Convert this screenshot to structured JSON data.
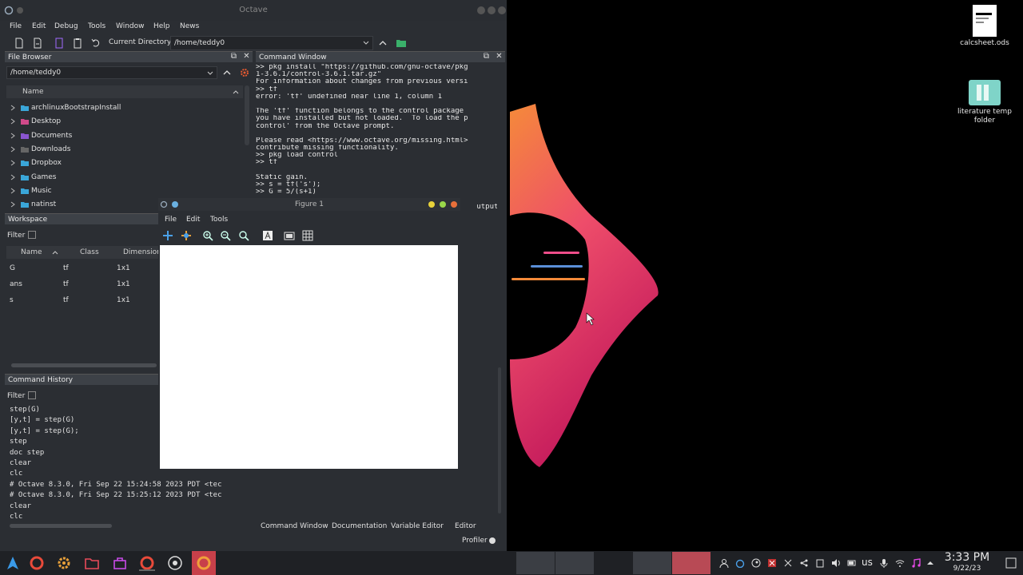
{
  "octave": {
    "title": "Octave",
    "menu": [
      "File",
      "Edit",
      "Debug",
      "Tools",
      "Window",
      "Help",
      "News"
    ],
    "current_directory_label": "Current Directory:",
    "current_directory": "/home/teddy0"
  },
  "file_browser": {
    "title": "File Browser",
    "path": "/home/teddy0",
    "column": "Name",
    "items": [
      {
        "name": "archlinuxBootstrapInstall",
        "color": "#3aa6d8"
      },
      {
        "name": "Desktop",
        "color": "#d04a8a"
      },
      {
        "name": "Documents",
        "color": "#8a55d0"
      },
      {
        "name": "Downloads",
        "color": "#666666"
      },
      {
        "name": "Dropbox",
        "color": "#3aa6d8"
      },
      {
        "name": "Games",
        "color": "#3aa6d8"
      },
      {
        "name": "Music",
        "color": "#3aa6d8"
      },
      {
        "name": "natinst",
        "color": "#3aa6d8"
      }
    ]
  },
  "workspace": {
    "title": "Workspace",
    "filter_label": "Filter",
    "columns": [
      "Name",
      "Class",
      "Dimension"
    ],
    "rows": [
      {
        "name": "G",
        "class": "tf",
        "dim": "1x1"
      },
      {
        "name": "ans",
        "class": "tf",
        "dim": "1x1"
      },
      {
        "name": "s",
        "class": "tf",
        "dim": "1x1"
      }
    ]
  },
  "history": {
    "title": "Command History",
    "filter_label": "Filter",
    "lines": [
      "step(G)",
      "[y,t] = step(G)",
      "[y,t] = step(G);",
      "step",
      "doc step",
      "clear",
      "clc",
      "# Octave 8.3.0, Fri Sep 22 15:24:58 2023 PDT <tec",
      "# Octave 8.3.0, Fri Sep 22 15:25:12 2023 PDT <tec",
      "clear",
      "clc"
    ]
  },
  "command_window": {
    "title": "Command Window",
    "lines": [
      ">> pkg install \"https://github.com/gnu-octave/pkg",
      "1-3.6.1/control-3.6.1.tar.gz\"",
      "For information about changes from previous versi",
      ">> tf",
      "error: 'tf' undefined near line 1, column 1",
      "",
      "The 'tf' function belongs to the control package",
      "you have installed but not loaded.  To load the p",
      "control' from the Octave prompt.",
      "",
      "Please read <https://www.octave.org/missing.html>",
      "contribute missing functionality.",
      ">> pkg load control",
      ">> tf",
      "",
      "Static gain.",
      ">> s = tf('s');",
      ">> G = 5/(s+1)",
      "",
      "                                                   utput ."
    ]
  },
  "bottom_tabs": [
    "Command Window",
    "Documentation",
    "Variable Editor",
    "Editor"
  ],
  "profiler_label": "Profiler",
  "figure": {
    "title": "Figure 1",
    "menu": [
      "File",
      "Edit",
      "Tools"
    ]
  },
  "desktop_icons": [
    {
      "label": "calcsheet.ods"
    },
    {
      "label": "literature temp folder"
    }
  ],
  "tray": {
    "keyboard_layout": "us",
    "time": "3:33 PM",
    "date": "9/22/23"
  },
  "colors": {
    "wallpaper_top": "#f58a3a",
    "wallpaper_bottom": "#c2185b",
    "accent": "#e0487a"
  }
}
